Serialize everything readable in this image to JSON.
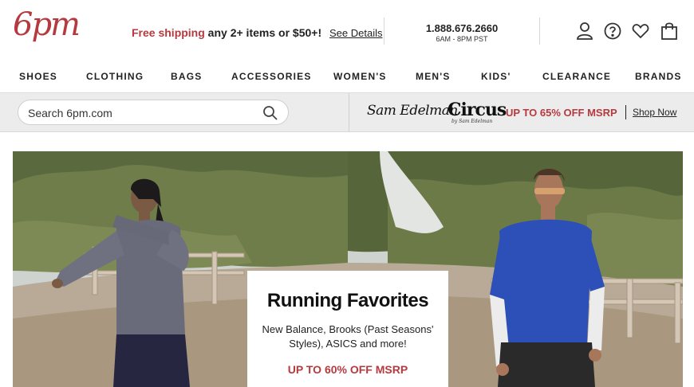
{
  "header": {
    "logo": "6pm",
    "promo": {
      "accent": "Free shipping",
      "rest": " any 2+ items or $50+!",
      "details_link": "See Details"
    },
    "phone": {
      "number": "1.888.676.2660",
      "hours": "6AM - 8PM PST"
    },
    "icons": [
      "account-icon",
      "help-icon",
      "favorites-heart-icon",
      "shopping-bag-icon"
    ]
  },
  "nav": {
    "items": [
      "SHOES",
      "CLOTHING",
      "BAGS",
      "ACCESSORIES",
      "WOMEN'S",
      "MEN'S",
      "KIDS'",
      "CLEARANCE",
      "BRANDS"
    ]
  },
  "search": {
    "placeholder": "Search 6pm.com",
    "value": ""
  },
  "brand_promo": {
    "brand_one": "Sam Edelman",
    "brand_two": "Circus",
    "brand_two_sub": "by Sam Edelman",
    "offer": "UP TO 65% OFF MSRP",
    "link": "Shop Now"
  },
  "hero": {
    "title": "Running Favorites",
    "subtitle": "New Balance, Brooks (Past Seasons' Styles), ASICS and more!",
    "offer": "UP TO 60% OFF MSRP"
  },
  "colors": {
    "brand_red": "#b53a3f",
    "band_gray": "#ececec",
    "men_shirt_blue": "#2d4fb8"
  }
}
